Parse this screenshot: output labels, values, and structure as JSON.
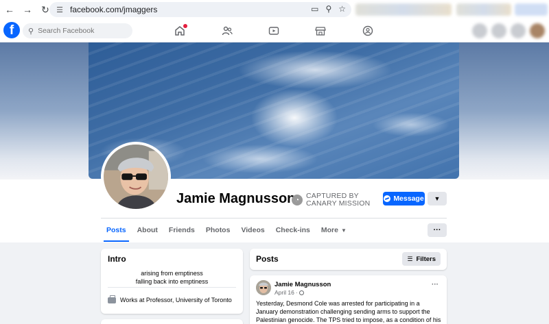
{
  "browser": {
    "url": "facebook.com/jmaggers",
    "back_icon": "back-arrow-icon",
    "forward_icon": "forward-arrow-icon",
    "reload_icon": "reload-icon"
  },
  "header": {
    "logo_glyph": "f",
    "search_placeholder": "Search Facebook",
    "nav_icons": [
      "home-icon",
      "friends-icon",
      "video-icon",
      "marketplace-icon",
      "groups-icon"
    ]
  },
  "profile": {
    "name": "Jamie Magnusson",
    "captured_line1": "CAPTURED BY",
    "captured_line2": "CANARY MISSION",
    "message_label": "Message"
  },
  "tabs": [
    {
      "label": "Posts",
      "active": true
    },
    {
      "label": "About"
    },
    {
      "label": "Friends"
    },
    {
      "label": "Photos"
    },
    {
      "label": "Videos"
    },
    {
      "label": "Check-ins"
    },
    {
      "label": "More"
    }
  ],
  "intro": {
    "title": "Intro",
    "bio_line1": "arising from emptiness",
    "bio_line2": "falling back into emptiness",
    "work": "Works at Professor, University of Toronto"
  },
  "posts": {
    "title": "Posts",
    "filters_label": "Filters"
  },
  "post": {
    "author": "Jamie Magnusson",
    "date": "April 16",
    "separator": "·",
    "text": "Yesterday, Desmond Cole was arrested for participating in a January demonstration challenging sending arms to support the Palestinian genocide. The TPS tried to impose, as a condition of his release, that"
  },
  "colors": {
    "brand_blue": "#0866ff",
    "page_bg": "#f0f2f5",
    "secondary_text": "#65676b"
  }
}
